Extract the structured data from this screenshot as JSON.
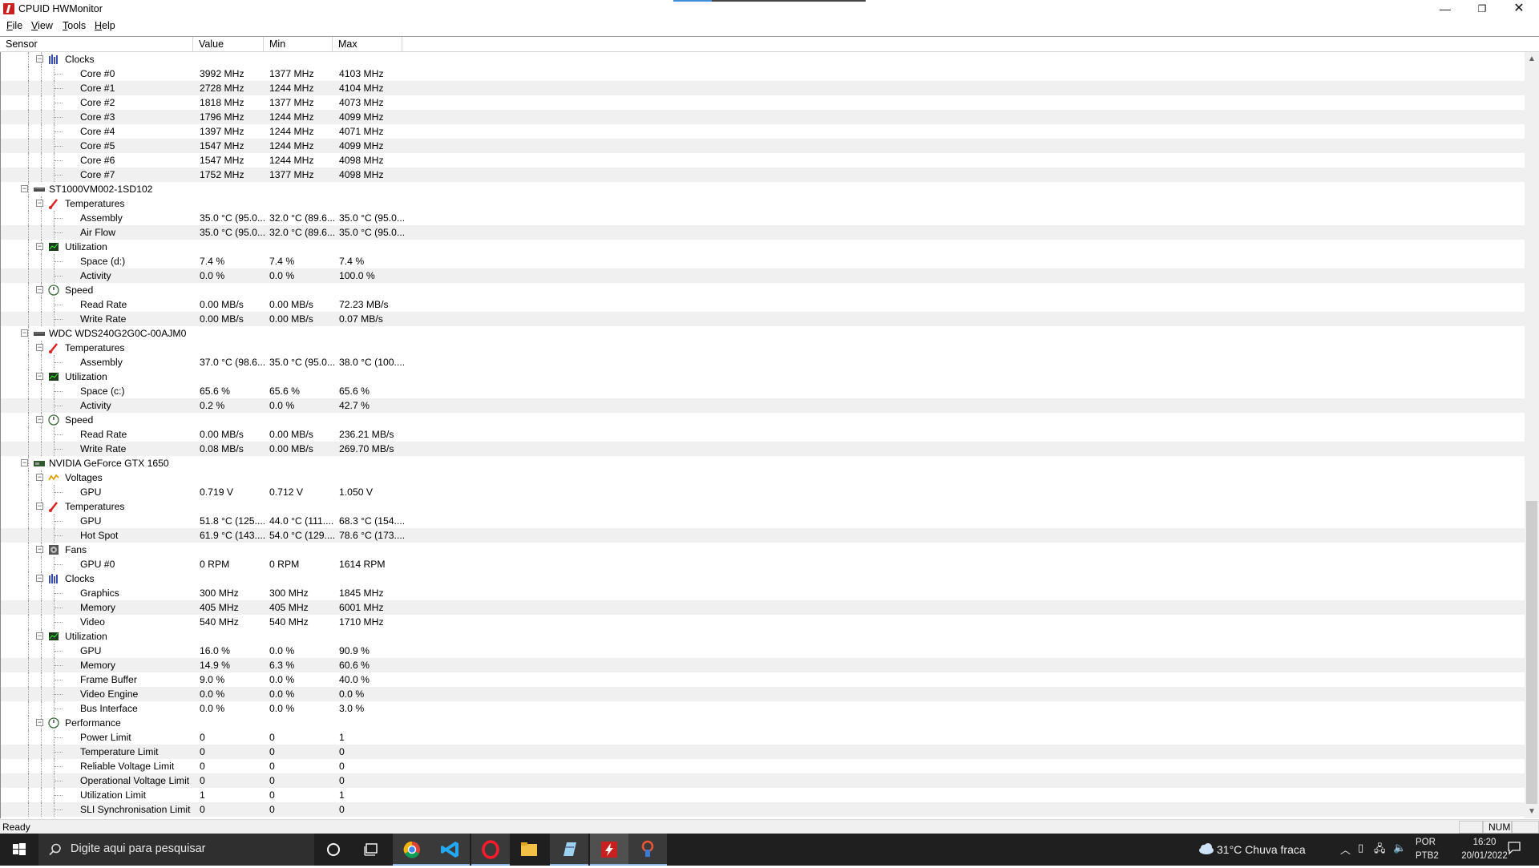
{
  "window": {
    "title": "CPUID HWMonitor",
    "min_glyph": "—",
    "max_glyph": "❐",
    "close_glyph": "✕"
  },
  "menu": {
    "file": "File",
    "view": "View",
    "tools": "Tools",
    "help": "Help"
  },
  "columns": {
    "sensor": "Sensor",
    "value": "Value",
    "min": "Min",
    "max": "Max"
  },
  "tree": [
    {
      "level": 2,
      "kind": "group",
      "icon": "clock-icon",
      "label": "Clocks"
    },
    {
      "level": 3,
      "label": "Core #0",
      "value": "3992 MHz",
      "min": "1377 MHz",
      "max": "4103 MHz"
    },
    {
      "level": 3,
      "label": "Core #1",
      "value": "2728 MHz",
      "min": "1244 MHz",
      "max": "4104 MHz"
    },
    {
      "level": 3,
      "label": "Core #2",
      "value": "1818 MHz",
      "min": "1377 MHz",
      "max": "4073 MHz"
    },
    {
      "level": 3,
      "label": "Core #3",
      "value": "1796 MHz",
      "min": "1244 MHz",
      "max": "4099 MHz"
    },
    {
      "level": 3,
      "label": "Core #4",
      "value": "1397 MHz",
      "min": "1244 MHz",
      "max": "4071 MHz"
    },
    {
      "level": 3,
      "label": "Core #5",
      "value": "1547 MHz",
      "min": "1244 MHz",
      "max": "4099 MHz"
    },
    {
      "level": 3,
      "label": "Core #6",
      "value": "1547 MHz",
      "min": "1244 MHz",
      "max": "4098 MHz"
    },
    {
      "level": 3,
      "label": "Core #7",
      "value": "1752 MHz",
      "min": "1377 MHz",
      "max": "4098 MHz"
    },
    {
      "level": 1,
      "kind": "device",
      "icon": "hdd-icon",
      "label": "ST1000VM002-1SD102"
    },
    {
      "level": 2,
      "kind": "group",
      "icon": "thermometer-icon",
      "label": "Temperatures"
    },
    {
      "level": 3,
      "label": "Assembly",
      "value": "35.0 °C  (95.0...",
      "min": "32.0 °C  (89.6...",
      "max": "35.0 °C  (95.0..."
    },
    {
      "level": 3,
      "label": "Air Flow",
      "value": "35.0 °C  (95.0...",
      "min": "32.0 °C  (89.6...",
      "max": "35.0 °C  (95.0..."
    },
    {
      "level": 2,
      "kind": "group",
      "icon": "utilization-icon",
      "label": "Utilization"
    },
    {
      "level": 3,
      "label": "Space (d:)",
      "value": "7.4 %",
      "min": "7.4 %",
      "max": "7.4 %"
    },
    {
      "level": 3,
      "label": "Activity",
      "value": "0.0 %",
      "min": "0.0 %",
      "max": "100.0 %"
    },
    {
      "level": 2,
      "kind": "group",
      "icon": "speed-icon",
      "label": "Speed"
    },
    {
      "level": 3,
      "label": "Read Rate",
      "value": "0.00 MB/s",
      "min": "0.00 MB/s",
      "max": "72.23 MB/s"
    },
    {
      "level": 3,
      "label": "Write Rate",
      "value": "0.00 MB/s",
      "min": "0.00 MB/s",
      "max": "0.07 MB/s"
    },
    {
      "level": 1,
      "kind": "device",
      "icon": "hdd-icon",
      "label": "WDC WDS240G2G0C-00AJM0"
    },
    {
      "level": 2,
      "kind": "group",
      "icon": "thermometer-icon",
      "label": "Temperatures"
    },
    {
      "level": 3,
      "label": "Assembly",
      "value": "37.0 °C  (98.6...",
      "min": "35.0 °C  (95.0...",
      "max": "38.0 °C  (100...."
    },
    {
      "level": 2,
      "kind": "group",
      "icon": "utilization-icon",
      "label": "Utilization"
    },
    {
      "level": 3,
      "label": "Space (c:)",
      "value": "65.6 %",
      "min": "65.6 %",
      "max": "65.6 %"
    },
    {
      "level": 3,
      "label": "Activity",
      "value": "0.2 %",
      "min": "0.0 %",
      "max": "42.7 %"
    },
    {
      "level": 2,
      "kind": "group",
      "icon": "speed-icon",
      "label": "Speed"
    },
    {
      "level": 3,
      "label": "Read Rate",
      "value": "0.00 MB/s",
      "min": "0.00 MB/s",
      "max": "236.21 MB/s"
    },
    {
      "level": 3,
      "label": "Write Rate",
      "value": "0.08 MB/s",
      "min": "0.00 MB/s",
      "max": "269.70 MB/s"
    },
    {
      "level": 1,
      "kind": "device",
      "icon": "gpu-icon",
      "label": "NVIDIA GeForce GTX 1650"
    },
    {
      "level": 2,
      "kind": "group",
      "icon": "voltage-icon",
      "label": "Voltages"
    },
    {
      "level": 3,
      "label": "GPU",
      "value": "0.719 V",
      "min": "0.712 V",
      "max": "1.050 V"
    },
    {
      "level": 2,
      "kind": "group",
      "icon": "thermometer-icon",
      "label": "Temperatures"
    },
    {
      "level": 3,
      "label": "GPU",
      "value": "51.8 °C  (125....",
      "min": "44.0 °C  (111....",
      "max": "68.3 °C  (154...."
    },
    {
      "level": 3,
      "label": "Hot Spot",
      "value": "61.9 °C  (143....",
      "min": "54.0 °C  (129....",
      "max": "78.6 °C  (173...."
    },
    {
      "level": 2,
      "kind": "group",
      "icon": "fan-icon",
      "label": "Fans"
    },
    {
      "level": 3,
      "label": "GPU #0",
      "value": "0 RPM",
      "min": "0 RPM",
      "max": "1614 RPM"
    },
    {
      "level": 2,
      "kind": "group",
      "icon": "clock-icon",
      "label": "Clocks"
    },
    {
      "level": 3,
      "label": "Graphics",
      "value": "300 MHz",
      "min": "300 MHz",
      "max": "1845 MHz"
    },
    {
      "level": 3,
      "label": "Memory",
      "value": "405 MHz",
      "min": "405 MHz",
      "max": "6001 MHz"
    },
    {
      "level": 3,
      "label": "Video",
      "value": "540 MHz",
      "min": "540 MHz",
      "max": "1710 MHz"
    },
    {
      "level": 2,
      "kind": "group",
      "icon": "utilization-icon",
      "label": "Utilization"
    },
    {
      "level": 3,
      "label": "GPU",
      "value": "16.0 %",
      "min": "0.0 %",
      "max": "90.9 %"
    },
    {
      "level": 3,
      "label": "Memory",
      "value": "14.9 %",
      "min": "6.3 %",
      "max": "60.6 %"
    },
    {
      "level": 3,
      "label": "Frame Buffer",
      "value": "9.0 %",
      "min": "0.0 %",
      "max": "40.0 %"
    },
    {
      "level": 3,
      "label": "Video Engine",
      "value": "0.0 %",
      "min": "0.0 %",
      "max": "0.0 %"
    },
    {
      "level": 3,
      "label": "Bus Interface",
      "value": "0.0 %",
      "min": "0.0 %",
      "max": "3.0 %"
    },
    {
      "level": 2,
      "kind": "group",
      "icon": "speed-icon",
      "label": "Performance"
    },
    {
      "level": 3,
      "label": "Power Limit",
      "value": "0",
      "min": "0",
      "max": "1"
    },
    {
      "level": 3,
      "label": "Temperature Limit",
      "value": "0",
      "min": "0",
      "max": "0"
    },
    {
      "level": 3,
      "label": "Reliable Voltage Limit",
      "value": "0",
      "min": "0",
      "max": "0"
    },
    {
      "level": 3,
      "label": "Operational Voltage Limit",
      "value": "0",
      "min": "0",
      "max": "0"
    },
    {
      "level": 3,
      "label": "Utilization Limit",
      "value": "1",
      "min": "0",
      "max": "1"
    },
    {
      "level": 3,
      "label": "SLI Synchronisation Limit",
      "value": "0",
      "min": "0",
      "max": "0"
    }
  ],
  "status": {
    "text": "Ready",
    "num": "NUM"
  },
  "taskbar": {
    "search_placeholder": "Digite aqui para pesquisar",
    "weather": "31°C  Chuva fraca",
    "lang_line1": "POR",
    "lang_line2": "PTB2",
    "time": "16:20",
    "date": "20/01/2022",
    "apps": [
      "windows-start-icon",
      "cortana-icon",
      "task-view-icon",
      "chrome-icon",
      "vscode-icon",
      "opera-icon",
      "file-explorer-icon",
      "notepad-icon",
      "hwmonitor-icon",
      "paint-icon"
    ]
  },
  "colors": {
    "alt_row": "#f0f0f0",
    "accent": "#c8201e",
    "taskbar": "#1f1f1f"
  }
}
